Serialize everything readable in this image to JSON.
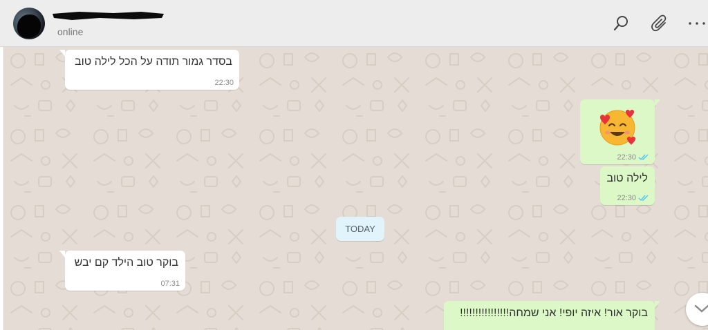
{
  "header": {
    "status": "online",
    "icons": [
      "search-icon",
      "attach-icon",
      "more-icon"
    ]
  },
  "messages": [
    {
      "direction": "incoming",
      "text": "בסדר גמור תודה על הכל לילה טוב",
      "time": "22:30"
    },
    {
      "direction": "outgoing",
      "text": "",
      "emoji": "smiling-face-with-hearts-emoji",
      "time": "22:30",
      "read": true
    },
    {
      "direction": "outgoing",
      "text": "לילה טוב",
      "time": "22:30",
      "read": true
    },
    {
      "direction": "incoming",
      "text": "בוקר טוב הילד קם יבש",
      "time": "07:31"
    },
    {
      "direction": "outgoing",
      "text": "בוקר אור! איזה יופי! אני שמחה!!!!!!!!!!!!!!!!"
    }
  ],
  "day_separator": "TODAY",
  "colors": {
    "header_bg": "#ededed",
    "chat_bg": "#e5ddd5",
    "incoming_bubble": "#ffffff",
    "outgoing_bubble": "#dcf8c6",
    "read_ticks": "#4fc3f7",
    "day_chip": "#e1f3fb"
  }
}
